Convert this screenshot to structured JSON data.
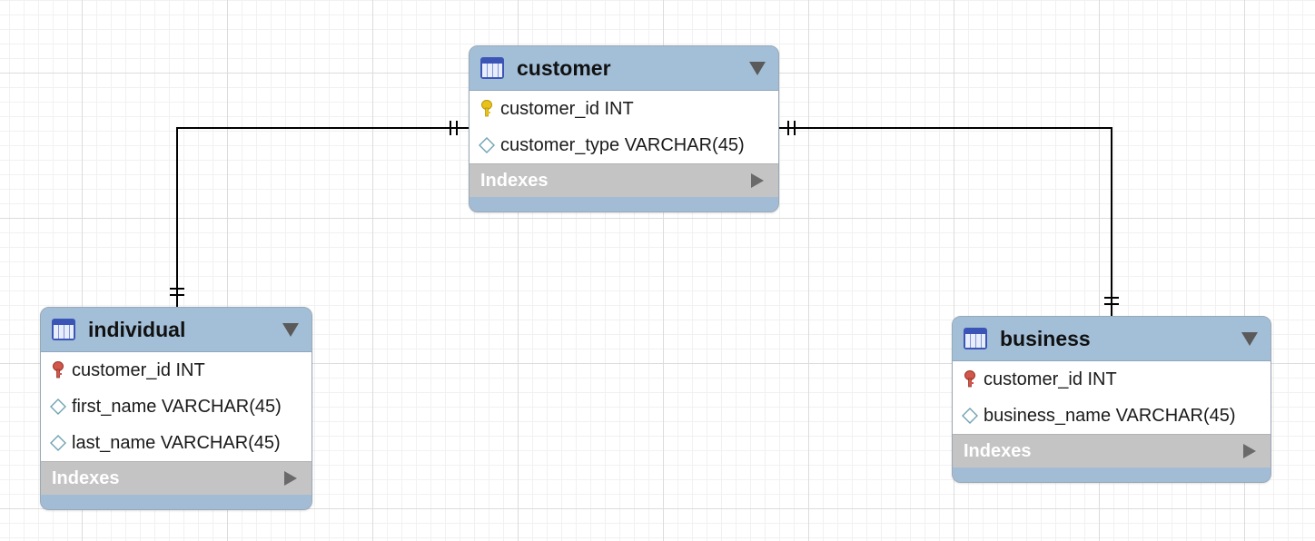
{
  "diagram": {
    "entities": [
      {
        "id": "customer",
        "name": "customer",
        "columns": [
          {
            "text": "customer_id INT",
            "kind": "primary-key"
          },
          {
            "text": "customer_type VARCHAR(45)",
            "kind": "column"
          }
        ],
        "indexes_label": "Indexes"
      },
      {
        "id": "individual",
        "name": "individual",
        "columns": [
          {
            "text": "customer_id INT",
            "kind": "primary-foreign-key"
          },
          {
            "text": "first_name VARCHAR(45)",
            "kind": "column"
          },
          {
            "text": "last_name VARCHAR(45)",
            "kind": "column"
          }
        ],
        "indexes_label": "Indexes"
      },
      {
        "id": "business",
        "name": "business",
        "columns": [
          {
            "text": "customer_id INT",
            "kind": "primary-foreign-key"
          },
          {
            "text": "business_name VARCHAR(45)",
            "kind": "column"
          }
        ],
        "indexes_label": "Indexes"
      }
    ],
    "relationships": [
      {
        "from": "customer",
        "to": "individual",
        "from_cardinality": "one-and-only-one",
        "to_cardinality": "one-and-only-one"
      },
      {
        "from": "customer",
        "to": "business",
        "from_cardinality": "one-and-only-one",
        "to_cardinality": "one-and-only-one"
      }
    ],
    "colors": {
      "header": "#a3bfd8",
      "indexes_bar": "#c4c4c4",
      "primary_key": "#e8c21a",
      "foreign_key": "#d0574a",
      "table_icon": "#3a55b5"
    }
  }
}
